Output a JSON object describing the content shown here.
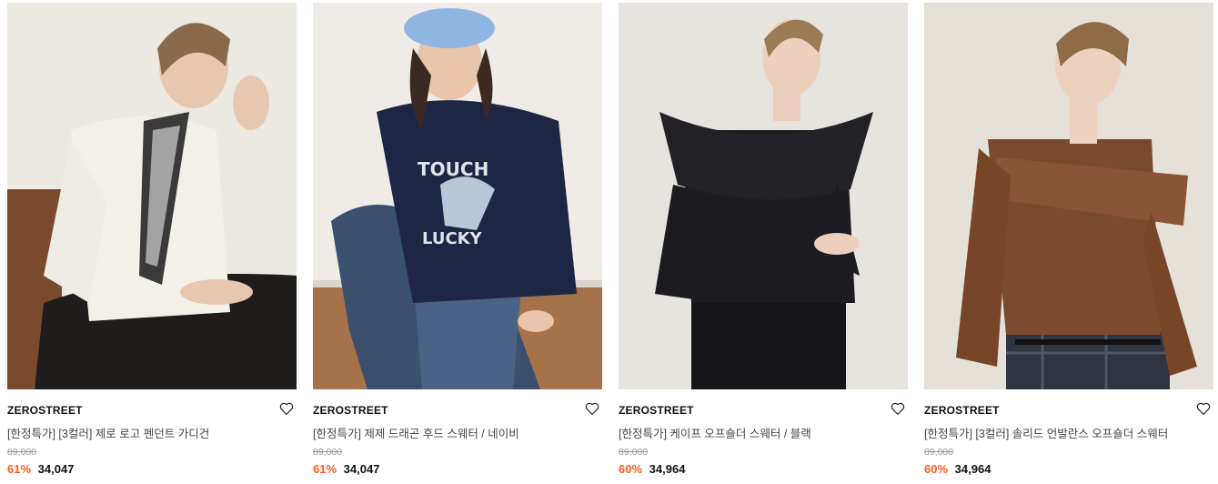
{
  "products": [
    {
      "brand": "ZEROSTREET",
      "name": "[한정특가] [3컬러] 제로 로고 펜던트 가디건",
      "original_price": "89,000",
      "discount": "61%",
      "price": "34,047",
      "image": "woman-white-cardigan-striped-scarf",
      "wishlist_icon": "heart-outline-icon"
    },
    {
      "brand": "ZEROSTREET",
      "name": "[한정특가] 제제 드래곤 후드 스웨터 / 네이비",
      "original_price": "89,000",
      "discount": "61%",
      "price": "34,047",
      "image": "woman-navy-hoodie-blue-beret",
      "wishlist_icon": "heart-outline-icon"
    },
    {
      "brand": "ZEROSTREET",
      "name": "[한정특가] 케이프 오프숄더 스웨터 / 블랙",
      "original_price": "89,000",
      "discount": "60%",
      "price": "34,964",
      "image": "woman-black-offshoulder-sweater",
      "wishlist_icon": "heart-outline-icon"
    },
    {
      "brand": "ZEROSTREET",
      "name": "[한정특가] [3컬러] 솔리드 언발란스 오프숄더 스웨터",
      "original_price": "89,000",
      "discount": "60%",
      "price": "34,964",
      "image": "woman-brown-offshoulder-sweater",
      "wishlist_icon": "heart-outline-icon"
    }
  ],
  "colors": {
    "discount": "#ff5a1f",
    "original_price": "#9a9a9a"
  }
}
